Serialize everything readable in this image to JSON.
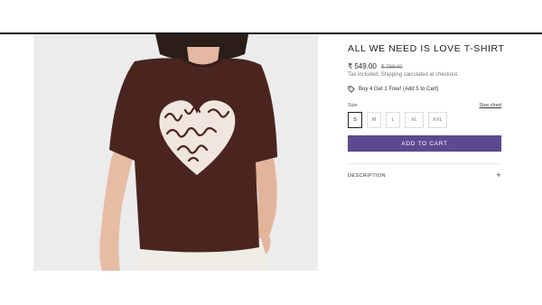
{
  "product": {
    "title": "ALL WE NEED IS LOVE T-SHIRT",
    "image_alt": "brown t-shirt with heart print",
    "price": "₹ 549.00",
    "compare_price": "₹ 799.00",
    "tax_note": "Tax included. Shipping calculated at checkout.",
    "offer_text": "Buy 4 Get 1 Free! (Add 5 to Cart)",
    "print_words": [
      "all we",
      "need is",
      "love"
    ]
  },
  "size_selector": {
    "label": "Size",
    "chart_link": "Size chart",
    "options": [
      "S",
      "M",
      "L",
      "XL",
      "XXL"
    ],
    "selected": "S"
  },
  "actions": {
    "add_to_cart": "ADD TO CART"
  },
  "accordion": {
    "description_label": "DESCRIPTION",
    "toggle_symbol": "+"
  },
  "colors": {
    "accent": "#5b4a8f",
    "shirt": "#4a2520",
    "print": "#f1e6de"
  }
}
